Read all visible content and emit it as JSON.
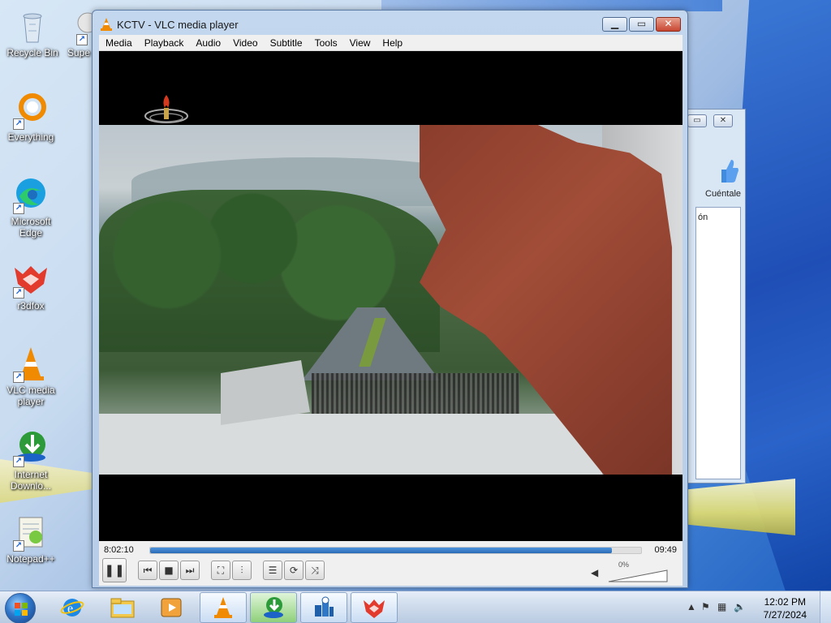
{
  "desktop": {
    "icons": [
      {
        "label": "Recycle Bin",
        "icon": "recycle-bin-icon"
      },
      {
        "label": "Supe",
        "icon": "app-shortcut-icon"
      },
      {
        "label": "Everything",
        "icon": "everything-search-icon"
      },
      {
        "label": "Microsoft Edge",
        "icon": "edge-browser-icon"
      },
      {
        "label": "r3dfox",
        "icon": "r3dfox-browser-icon"
      },
      {
        "label": "VLC media player",
        "icon": "vlc-cone-icon"
      },
      {
        "label": "Internet Downlo...",
        "icon": "internet-download-manager-icon"
      },
      {
        "label": "Notepad++",
        "icon": "notepadpp-icon"
      }
    ]
  },
  "background_window": {
    "label": "Cuéntale",
    "column_fragment": "ón"
  },
  "vlc": {
    "title": "KCTV - VLC media player",
    "menu": [
      "Media",
      "Playback",
      "Audio",
      "Video",
      "Subtitle",
      "Tools",
      "View",
      "Help"
    ],
    "current_time": "8:02:10",
    "total_time": "09:49",
    "progress": 0.94,
    "volume_percent": "0%",
    "controls": {
      "play_pause": "pause-icon",
      "prev": "previous-icon",
      "stop": "stop-icon",
      "next": "next-icon",
      "fullscreen": "fullscreen-icon",
      "extended": "extended-settings-icon",
      "playlist": "playlist-icon",
      "loop": "loop-icon",
      "random": "shuffle-icon"
    }
  },
  "taskbar": {
    "time": "12:02 PM",
    "date": "7/27/2024",
    "pinned": [
      "internet-explorer-icon",
      "file-explorer-icon",
      "media-player-icon",
      "vlc-cone-icon",
      "internet-download-manager-icon",
      "network-tool-icon",
      "r3dfox-browser-icon"
    ]
  },
  "colors": {
    "vlc_orange": "#f08a00",
    "progress_blue": "#2c6cb6",
    "close_red": "#c74631"
  }
}
